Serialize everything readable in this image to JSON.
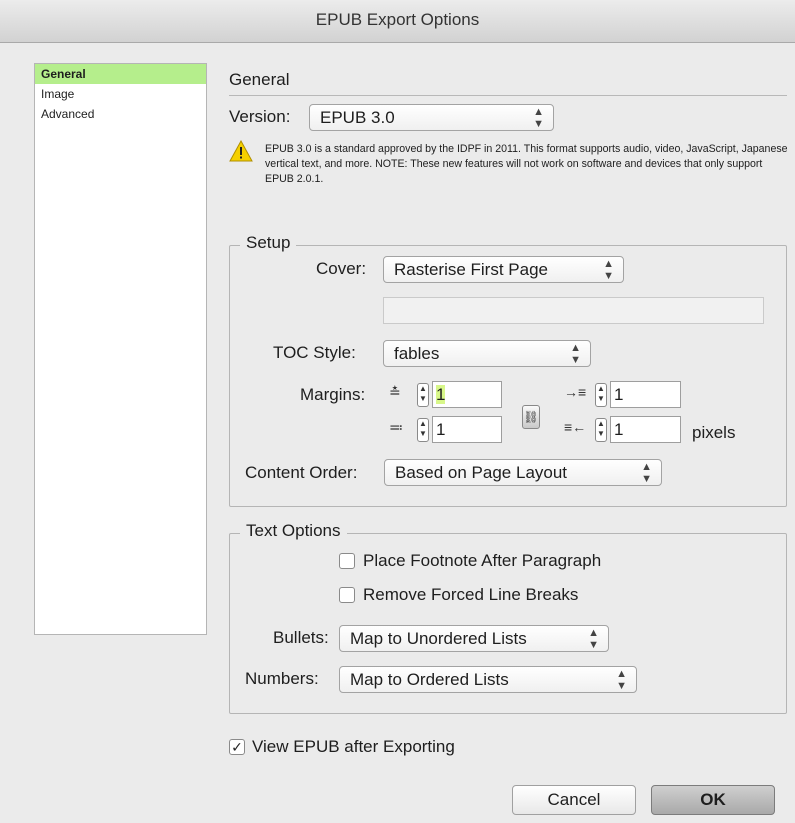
{
  "window": {
    "title": "EPUB Export Options"
  },
  "sidebar": {
    "items": [
      {
        "label": "General"
      },
      {
        "label": "Image"
      },
      {
        "label": "Advanced"
      }
    ]
  },
  "general": {
    "heading": "General",
    "version_label": "Version:",
    "version_value": "EPUB 3.0",
    "note": "EPUB 3.0 is a standard approved by the IDPF in 2011. This format supports audio, video, JavaScript, Japanese vertical text, and more. NOTE: These new features will not work on software and devices that only support EPUB 2.0.1."
  },
  "setup": {
    "legend": "Setup",
    "cover_label": "Cover:",
    "cover_value": "Rasterise First Page",
    "cover_path": "",
    "toc_label": "TOC Style:",
    "toc_value": "fables",
    "margins_label": "Margins:",
    "margin_top": "1",
    "margin_bottom": "1",
    "margin_left": "1",
    "margin_right": "1",
    "margins_unit": "pixels",
    "content_order_label": "Content Order:",
    "content_order_value": "Based on Page Layout"
  },
  "text_options": {
    "legend": "Text Options",
    "footnote_label": "Place Footnote After Paragraph",
    "footnote_checked": false,
    "line_breaks_label": "Remove Forced Line Breaks",
    "line_breaks_checked": false,
    "bullets_label": "Bullets:",
    "bullets_value": "Map to Unordered Lists",
    "numbers_label": "Numbers:",
    "numbers_value": "Map to Ordered Lists"
  },
  "view_after": {
    "label": "View EPUB after Exporting",
    "checked": true
  },
  "buttons": {
    "cancel": "Cancel",
    "ok": "OK"
  },
  "icons": {
    "warning": "warning-icon",
    "popup_arrows": "updown-arrows-icon",
    "chain": "chain-link-icon",
    "margin_top": "margin-top-icon",
    "margin_bottom": "margin-bottom-icon",
    "margin_left": "margin-left-icon",
    "margin_right": "margin-right-icon"
  },
  "colors": {
    "selection": "#b5ee8c",
    "highlight": "#d8f78a",
    "warning": "#f5d000"
  }
}
